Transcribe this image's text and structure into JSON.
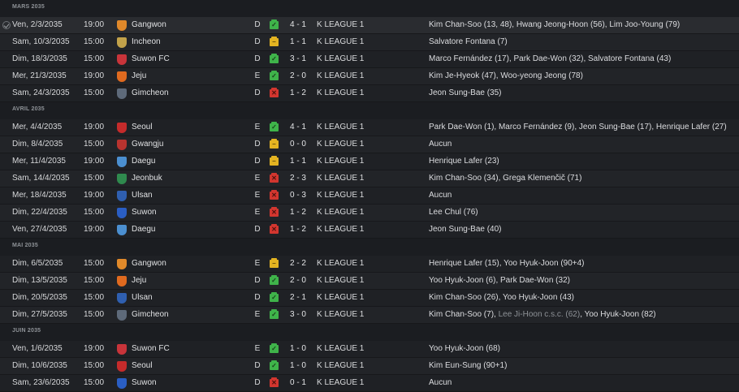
{
  "colors": {
    "win": "#3fb34a",
    "draw": "#e3b321",
    "loss": "#d2362f"
  },
  "months": [
    {
      "label": "MARS 2035",
      "matches": [
        {
          "date": "Ven, 2/3/2035",
          "time": "19:00",
          "team": "Gangwon",
          "venue": "D",
          "result": "w",
          "score": "4 - 1",
          "competition": "K LEAGUE 1",
          "scorers": "Kim Chan-Soo (13, 48), Hwang Jeong-Hoon (56), Lim Joo-Young (79)",
          "badge_color": "#e0892a"
        },
        {
          "date": "Sam, 10/3/2035",
          "time": "15:00",
          "team": "Incheon",
          "venue": "D",
          "result": "d",
          "score": "1 - 1",
          "competition": "K LEAGUE 1",
          "scorers": "Salvatore Fontana (7)",
          "badge_color": "#c2a24a"
        },
        {
          "date": "Dim, 18/3/2035",
          "time": "15:00",
          "team": "Suwon FC",
          "venue": "D",
          "result": "w",
          "score": "3 - 1",
          "competition": "K LEAGUE 1",
          "scorers": "Marco Fernández (17), Park Dae-Won (32), Salvatore Fontana (43)",
          "badge_color": "#c8343a"
        },
        {
          "date": "Mer, 21/3/2035",
          "time": "19:00",
          "team": "Jeju",
          "venue": "E",
          "result": "w",
          "score": "2 - 0",
          "competition": "K LEAGUE 1",
          "scorers": "Kim Je-Hyeok (47), Woo-yeong Jeong (78)",
          "badge_color": "#e06a1f"
        },
        {
          "date": "Sam, 24/3/2035",
          "time": "15:00",
          "team": "Gimcheon",
          "venue": "D",
          "result": "l",
          "score": "1 - 2",
          "competition": "K LEAGUE 1",
          "scorers": "Jeon Sung-Bae (35)",
          "badge_color": "#5e6a7a"
        }
      ]
    },
    {
      "label": "AVRIL 2035",
      "matches": [
        {
          "date": "Mer, 4/4/2035",
          "time": "19:00",
          "team": "Seoul",
          "venue": "E",
          "result": "w",
          "score": "4 - 1",
          "competition": "K LEAGUE 1",
          "scorers": "Park Dae-Won (1), Marco Fernández (9), Jeon Sung-Bae (17), Henrique Lafer (27)",
          "badge_color": "#c52b2b"
        },
        {
          "date": "Dim, 8/4/2035",
          "time": "15:00",
          "team": "Gwangju",
          "venue": "D",
          "result": "d",
          "score": "0 - 0",
          "competition": "K LEAGUE 1",
          "scorers": "Aucun",
          "badge_color": "#b8332f"
        },
        {
          "date": "Mer, 11/4/2035",
          "time": "19:00",
          "team": "Daegu",
          "venue": "D",
          "result": "d",
          "score": "1 - 1",
          "competition": "K LEAGUE 1",
          "scorers": "Henrique Lafer (23)",
          "badge_color": "#4b8fd0"
        },
        {
          "date": "Sam, 14/4/2035",
          "time": "15:00",
          "team": "Jeonbuk",
          "venue": "E",
          "result": "l",
          "score": "2 - 3",
          "competition": "K LEAGUE 1",
          "scorers": "Kim Chan-Soo (34), Grega Klemenčič (71)",
          "badge_color": "#2f8a4e"
        },
        {
          "date": "Mer, 18/4/2035",
          "time": "19:00",
          "team": "Ulsan",
          "venue": "E",
          "result": "l",
          "score": "0 - 3",
          "competition": "K LEAGUE 1",
          "scorers": "Aucun",
          "badge_color": "#2f5fb0"
        },
        {
          "date": "Dim, 22/4/2035",
          "time": "15:00",
          "team": "Suwon",
          "venue": "E",
          "result": "l",
          "score": "1 - 2",
          "competition": "K LEAGUE 1",
          "scorers": "Lee Chul (76)",
          "badge_color": "#2a5ec4"
        },
        {
          "date": "Ven, 27/4/2035",
          "time": "19:00",
          "team": "Daegu",
          "venue": "D",
          "result": "l",
          "score": "1 - 2",
          "competition": "K LEAGUE 1",
          "scorers": "Jeon Sung-Bae (40)",
          "badge_color": "#4b8fd0"
        }
      ]
    },
    {
      "label": "MAI 2035",
      "matches": [
        {
          "date": "Dim, 6/5/2035",
          "time": "15:00",
          "team": "Gangwon",
          "venue": "E",
          "result": "d",
          "score": "2 - 2",
          "competition": "K LEAGUE 1",
          "scorers": "Henrique Lafer (15), Yoo Hyuk-Joon (90+4)",
          "badge_color": "#e0892a"
        },
        {
          "date": "Dim, 13/5/2035",
          "time": "15:00",
          "team": "Jeju",
          "venue": "D",
          "result": "w",
          "score": "2 - 0",
          "competition": "K LEAGUE 1",
          "scorers": "Yoo Hyuk-Joon (6), Park Dae-Won (32)",
          "badge_color": "#e06a1f"
        },
        {
          "date": "Dim, 20/5/2035",
          "time": "15:00",
          "team": "Ulsan",
          "venue": "D",
          "result": "w",
          "score": "2 - 1",
          "competition": "K LEAGUE 1",
          "scorers": "Kim Chan-Soo (26), Yoo Hyuk-Joon (43)",
          "badge_color": "#2f5fb0"
        },
        {
          "date": "Dim, 27/5/2035",
          "time": "15:00",
          "team": "Gimcheon",
          "venue": "E",
          "result": "w",
          "score": "3 - 0",
          "competition": "K LEAGUE 1",
          "scorers_parts": [
            "Kim Chan-Soo (7), ",
            "Lee Ji-Hoon c.s.c. (62)",
            ", Yoo Hyuk-Joon (82)"
          ],
          "badge_color": "#5e6a7a"
        }
      ]
    },
    {
      "label": "JUIN 2035",
      "matches": [
        {
          "date": "Ven, 1/6/2035",
          "time": "19:00",
          "team": "Suwon FC",
          "venue": "E",
          "result": "w",
          "score": "1 - 0",
          "competition": "K LEAGUE 1",
          "scorers": "Yoo Hyuk-Joon (68)",
          "badge_color": "#c8343a"
        },
        {
          "date": "Dim, 10/6/2035",
          "time": "15:00",
          "team": "Seoul",
          "venue": "D",
          "result": "w",
          "score": "1 - 0",
          "competition": "K LEAGUE 1",
          "scorers": "Kim Eun-Sung (90+1)",
          "badge_color": "#c52b2b"
        },
        {
          "date": "Sam, 23/6/2035",
          "time": "15:00",
          "team": "Suwon",
          "venue": "D",
          "result": "l",
          "score": "0 - 1",
          "competition": "K LEAGUE 1",
          "scorers": "Aucun",
          "badge_color": "#2a5ec4"
        }
      ]
    }
  ]
}
